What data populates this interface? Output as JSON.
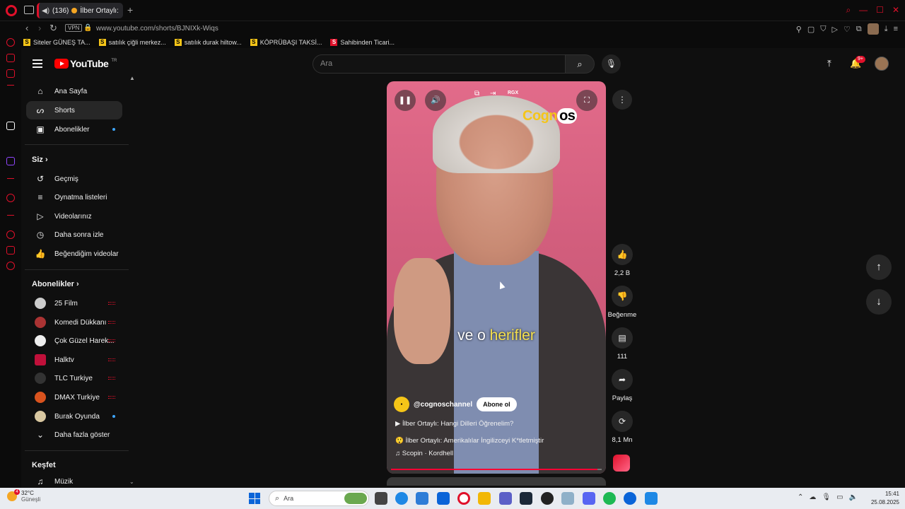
{
  "browser": {
    "tab_count": "(136)",
    "tab_title": "İlber Ortaylı:",
    "url": "www.youtube.com/shorts/BJNIXk-Wiqs",
    "vpn_label": "VPN"
  },
  "bookmarks": [
    {
      "icon": "S",
      "label": "Siteler GÜNEŞ TA..."
    },
    {
      "icon": "S",
      "label": "satılık çiğli merkez..."
    },
    {
      "icon": "S",
      "label": "satılık durak hiltow..."
    },
    {
      "icon": "S",
      "label": "KÖPRÜBAŞI TAKSİ..."
    },
    {
      "icon": "S",
      "label": "Sahibinden Ticari..."
    }
  ],
  "header": {
    "logo_text": "YouTube",
    "logo_suffix": "TR",
    "search_placeholder": "Ara",
    "notif_badge": "9+"
  },
  "sidebar": {
    "main": [
      {
        "label": "Ana Sayfa",
        "icon": "home-icon"
      },
      {
        "label": "Shorts",
        "icon": "shorts-icon"
      },
      {
        "label": "Abonelikler",
        "icon": "subscriptions-icon"
      }
    ],
    "siz_title": "Siz",
    "siz": [
      {
        "label": "Geçmiş",
        "icon": "history-icon"
      },
      {
        "label": "Oynatma listeleri",
        "icon": "playlists-icon"
      },
      {
        "label": "Videolarınız",
        "icon": "your-videos-icon"
      },
      {
        "label": "Daha sonra izle",
        "icon": "watch-later-icon"
      },
      {
        "label": "Beğendiğim videolar",
        "icon": "liked-icon"
      }
    ],
    "subs_title": "Abonelikler",
    "subs": [
      {
        "label": "25 Film"
      },
      {
        "label": "Komedi Dükkanı"
      },
      {
        "label": "Çok Güzel Harek..."
      },
      {
        "label": "Halktv"
      },
      {
        "label": "TLC Turkiye"
      },
      {
        "label": "DMAX Turkiye"
      },
      {
        "label": "Burak Oyunda"
      }
    ],
    "show_more": "Daha fazla göster",
    "explore_title": "Keşfet",
    "explore": [
      {
        "label": "Müzik"
      }
    ]
  },
  "video": {
    "overlay_label": "RGX",
    "brand_text_a": "Cogn",
    "brand_text_b": "os",
    "caption_a": "ve o ",
    "caption_b": "herifler",
    "channel": "@cognoschannel",
    "subscribe": "Abone ol",
    "line1": "İlber Ortaylı: Hangi Dilleri Öğrenelim?",
    "line2": "İlber Ortaylı: Amerikalılar İngilizceyi K*tletmiştir",
    "music": "Scopin · Kordhell",
    "progress": 0.98
  },
  "actions": {
    "likes": "2,2 B",
    "dislike": "Beğenme",
    "comments": "111",
    "share": "Paylaş",
    "remix": "8,1 Mn"
  },
  "taskbar": {
    "temp": "32°C",
    "weather": "Güneşli",
    "weather_badge": "4",
    "search": "Ara",
    "time": "15:41",
    "date": "25.08.2025"
  },
  "colors": {
    "accent_red": "#ff0033",
    "opera_red": "#e0102a",
    "bg": "#0f0f0f"
  }
}
